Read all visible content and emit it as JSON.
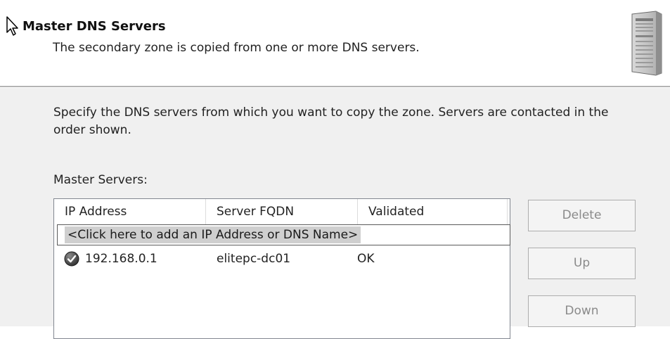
{
  "header": {
    "title": "Master DNS Servers",
    "subtitle": "The secondary zone is copied from one or more DNS servers.",
    "icon": "server-icon"
  },
  "content": {
    "description": "Specify the DNS servers from which you want to copy the zone.  Servers are contacted in the order shown.",
    "list_label": "Master Servers:"
  },
  "master_servers": {
    "columns": [
      "IP Address",
      "Server FQDN",
      "Validated"
    ],
    "add_placeholder": "<Click here to add an IP Address or DNS Name>",
    "rows": [
      {
        "ip": "192.168.0.1",
        "fqdn": "elitepc-dc01",
        "validated": "OK",
        "status_icon": "check-icon"
      }
    ]
  },
  "buttons": {
    "delete": "Delete",
    "up": "Up",
    "down": "Down"
  },
  "colors": {
    "content_background": "#f0f0f0",
    "disabled_text": "#8a8a8a",
    "selection_background": "#cfcfcf"
  }
}
